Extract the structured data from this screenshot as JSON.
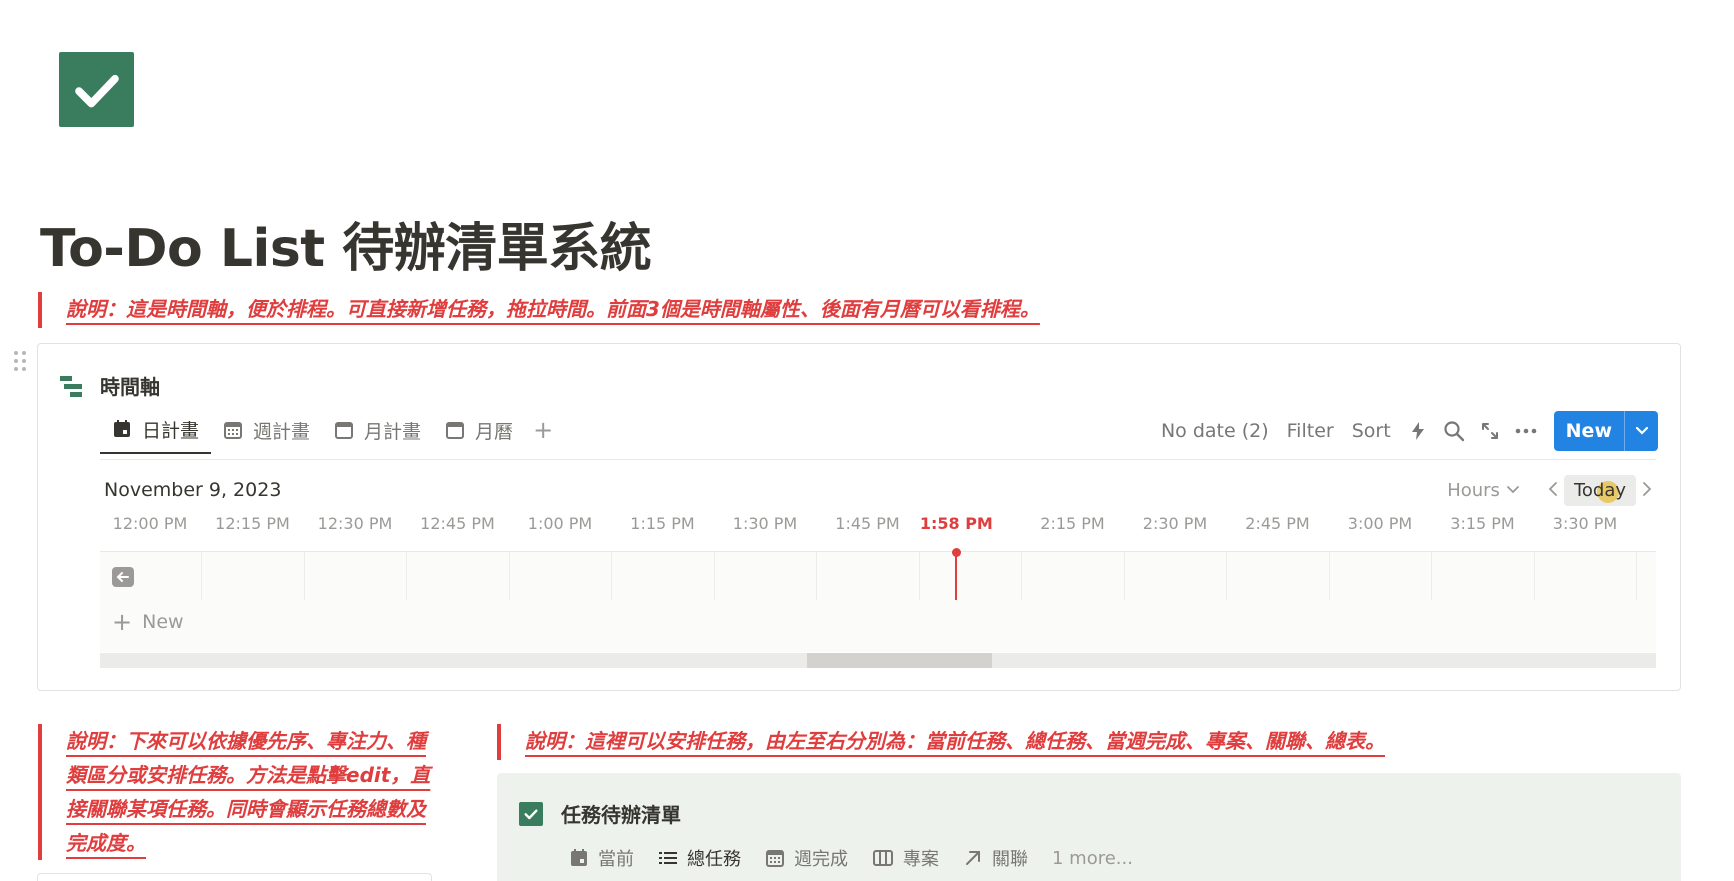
{
  "page": {
    "icon": "check-icon",
    "title": "To-Do List 待辦清單系統",
    "accent_color": "#3a7d5e",
    "note_color": "#e03e3e"
  },
  "notes": {
    "timeline_note": "說明：這是時間軸，便於排程。可直接新增任務，拖拉時間。前面3個是時間軸屬性、後面有月曆可以看排程。",
    "left_note": "說明：下來可以依據優先序、專注力、種類區分或安排任務。方法是點擊edit，直接關聯某項任務。同時會顯示任務總數及完成度。",
    "right_note": "說明：這裡可以安排任務，由左至右分別為：當前任務、總任務、當週完成、專案、關聯、總表。"
  },
  "timeline": {
    "title": "時間軸",
    "icon": "timeline-icon",
    "views": [
      {
        "label": "日計畫",
        "icon": "calendar-filled-icon",
        "active": true
      },
      {
        "label": "週計畫",
        "icon": "calendar-grid-icon",
        "active": false
      },
      {
        "label": "月計畫",
        "icon": "calendar-icon",
        "active": false
      },
      {
        "label": "月曆",
        "icon": "calendar-icon",
        "active": false
      }
    ],
    "add_view": "+",
    "toolbar": {
      "no_date": "No date (2)",
      "filter": "Filter",
      "sort": "Sort",
      "new_label": "New",
      "new_color": "#2383e2"
    },
    "date": "November 9, 2023",
    "zoom": "Hours",
    "today": "Today",
    "times": [
      "12:00 PM",
      "12:15 PM",
      "12:30 PM",
      "12:45 PM",
      "1:00 PM",
      "1:15 PM",
      "1:30 PM",
      "1:45 PM",
      "1:58 PM",
      "2:15 PM",
      "2:30 PM",
      "2:45 PM",
      "3:00 PM",
      "3:15 PM",
      "3:30 PM"
    ],
    "now_label": "1:58 PM",
    "add_new": "New"
  },
  "tasks": {
    "title": "任務待辦清單",
    "tabs": [
      {
        "label": "當前",
        "icon": "calendar-filled-icon"
      },
      {
        "label": "總任務",
        "icon": "list-icon"
      },
      {
        "label": "週完成",
        "icon": "calendar-grid-icon"
      },
      {
        "label": "專案",
        "icon": "board-icon"
      },
      {
        "label": "關聯",
        "icon": "arrow-up-right-icon"
      },
      {
        "label": "1 more...",
        "icon": ""
      }
    ]
  }
}
